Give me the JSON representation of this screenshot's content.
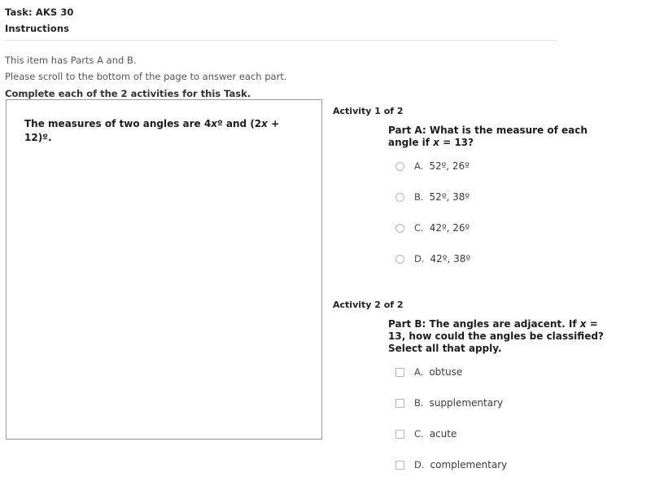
{
  "header": {
    "task_title": "Task: AKS 30",
    "instructions_title": "Instructions"
  },
  "intro": {
    "line1": "This item has Parts A and B.",
    "line2": "Please scroll to the bottom of the page to answer each part.",
    "line3": "Complete each of the 2 activities for this Task."
  },
  "stimulus": {
    "text_part1": "The measures of two angles are 4",
    "text_var1": "x",
    "text_part2": "º and (2",
    "text_var2": "x",
    "text_part3": " + 12)º."
  },
  "activities": [
    {
      "label": "Activity 1 of 2",
      "question_part1": "Part A: What is the measure of each angle if ",
      "question_var": "x",
      "question_part2": " = 13?",
      "input_type": "radio",
      "options": [
        {
          "letter": "A.",
          "text": "52º, 26º"
        },
        {
          "letter": "B.",
          "text": "52º, 38º"
        },
        {
          "letter": "C.",
          "text": "42º, 26º"
        },
        {
          "letter": "D.",
          "text": "42º, 38º"
        }
      ]
    },
    {
      "label": "Activity 2 of 2",
      "question_part1": "Part B: The angles are adjacent. If ",
      "question_var": "x",
      "question_part2": " = 13, how could the angles be classified? Select all that apply.",
      "input_type": "checkbox",
      "options": [
        {
          "letter": "A.",
          "text": "obtuse"
        },
        {
          "letter": "B.",
          "text": "supplementary"
        },
        {
          "letter": "C.",
          "text": "acute"
        },
        {
          "letter": "D.",
          "text": "complementary"
        }
      ]
    }
  ],
  "colors": {
    "border": "#9a9a9a",
    "divider": "#e2e2e2",
    "control_border": "#b6b6b6",
    "text": "#3b3b3b"
  }
}
